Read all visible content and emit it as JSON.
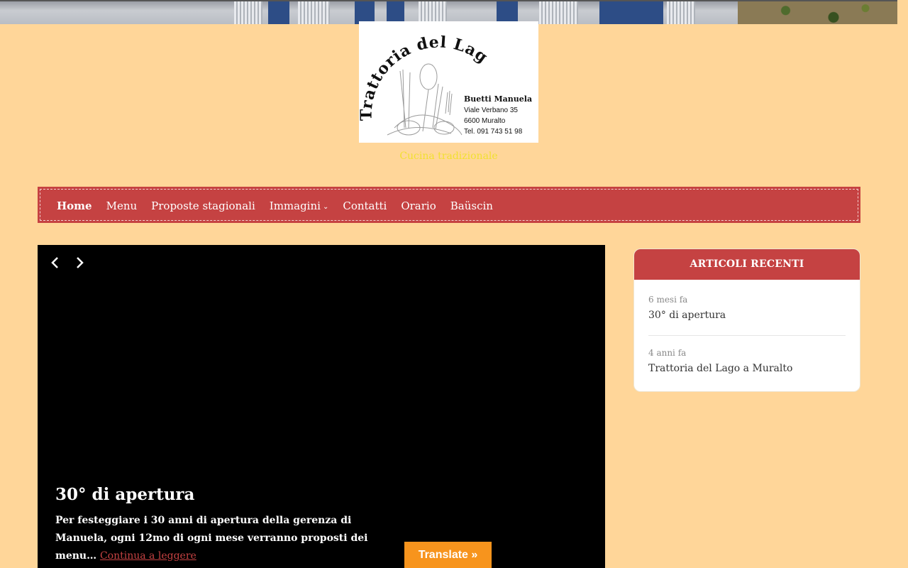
{
  "site": {
    "logo": {
      "name": "Trattoria del Lago",
      "owner": "Buetti Manuela",
      "address": "Viale Verbano 35",
      "city": "6600 Muralto",
      "phone": "Tel. 091 743 51 98"
    },
    "tagline": "Cucina tradizionale"
  },
  "nav": {
    "items": [
      {
        "label": "Home",
        "active": true
      },
      {
        "label": "Menu"
      },
      {
        "label": "Proposte stagionali"
      },
      {
        "label": "Immagini",
        "has_submenu": true
      },
      {
        "label": "Contatti"
      },
      {
        "label": "Orario"
      },
      {
        "label": "Baüscin"
      }
    ]
  },
  "slider": {
    "title": "30° di apertura",
    "excerpt": "Per festeggiare i 30 anni di apertura della gerenza di Manuela, ogni 12mo di ogni mese verranno proposti dei menu…",
    "read_more": "Continua a leggere"
  },
  "translate_button": "Translate »",
  "sidebar": {
    "widget_title": "ARTICOLI RECENTI",
    "posts": [
      {
        "time": "6 mesi fa",
        "title": "30° di apertura"
      },
      {
        "time": "4 anni fa",
        "title": "Trattoria del Lago a Muralto"
      }
    ]
  },
  "colors": {
    "background": "#FFD699",
    "accent": "#c54242",
    "tagline": "#f2e030",
    "translate": "#f7941d"
  }
}
